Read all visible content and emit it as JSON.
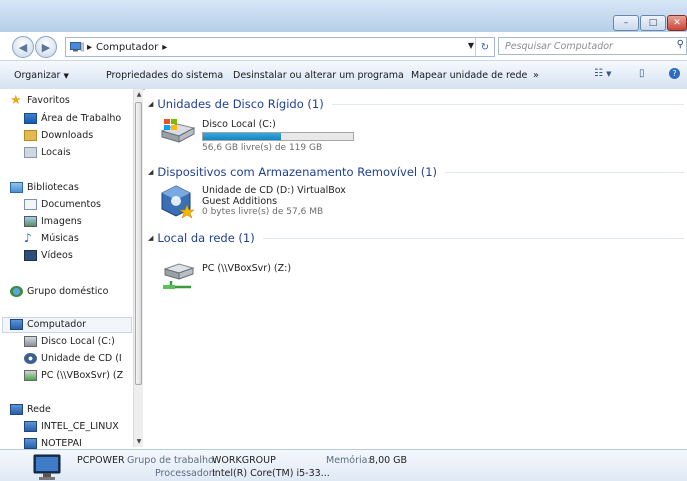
{
  "window": {
    "min_icon": "minimize-icon",
    "max_icon": "maximize-icon",
    "close_icon": "close-icon"
  },
  "nav": {
    "back_icon": "back-arrow-icon",
    "forward_icon": "forward-arrow-icon",
    "address_crumb": "Computador",
    "search_placeholder": "Pesquisar Computador"
  },
  "toolbar": {
    "organize": "Organizar",
    "system_properties": "Propriedades do sistema",
    "uninstall": "Desinstalar ou alterar um programa",
    "map_drive": "Mapear unidade de rede",
    "more": "»"
  },
  "sidebar": {
    "favorites": "Favoritos",
    "desktop": "Área de Trabalho",
    "downloads": "Downloads",
    "places": "Locais",
    "libraries": "Bibliotecas",
    "documents": "Documentos",
    "images": "Imagens",
    "music": "Músicas",
    "videos": "Vídeos",
    "homegroup": "Grupo doméstico",
    "computer": "Computador",
    "local_disk": "Disco Local (C:)",
    "cd_drive": "Unidade de CD (I",
    "net_drive": "PC (\\\\VBoxSvr) (Z",
    "network": "Rede",
    "net_host1": "INTEL_CE_LINUX",
    "net_host2": "NOTEPAI"
  },
  "main": {
    "group_hdd": "Unidades de Disco Rígido (1)",
    "disk_name": "Disco Local (C:)",
    "disk_space": "56,6 GB livre(s) de 119 GB",
    "disk_used_fraction": 0.52,
    "group_removable": "Dispositivos com Armazenamento Removível (1)",
    "cd_name_line1": "Unidade de CD (D:) VirtualBox",
    "cd_name_line2": "Guest Additions",
    "cd_space": "0 bytes livre(s) de 57,6 MB",
    "group_network": "Local da rede (1)",
    "net_name": "PC (\\\\VBoxSvr) (Z:)"
  },
  "details": {
    "computer_name": "PCPOWER",
    "workgroup_label": "Grupo de trabalho:",
    "workgroup": "WORKGROUP",
    "memory_label": "Memória:",
    "memory": "8,00 GB",
    "processor_label": "Processador:",
    "processor": "Intel(R) Core(TM) i5-33..."
  }
}
